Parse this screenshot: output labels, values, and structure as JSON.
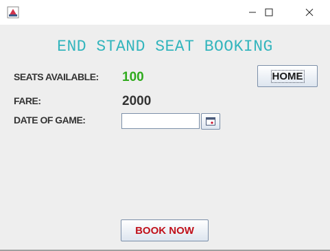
{
  "window": {
    "minimize_icon": "minimize-icon",
    "maximize_icon": "maximize-icon",
    "close_icon": "close-icon",
    "app_icon": "java-app-icon"
  },
  "header": {
    "title": "END STAND SEAT BOOKING"
  },
  "seats": {
    "label": "SEATS AVAILABLE:",
    "value": "100",
    "value_color": "#2eaa1c"
  },
  "fare": {
    "label": "FARE:",
    "value": "2000",
    "value_color": "#333333"
  },
  "date": {
    "label": "DATE OF GAME:",
    "value": "",
    "calendar_icon": "calendar-icon"
  },
  "buttons": {
    "home": "HOME",
    "book_now": "BOOK NOW",
    "book_now_color": "#c0101a"
  },
  "colors": {
    "title": "#33b5bd",
    "background": "#eeeeee"
  }
}
